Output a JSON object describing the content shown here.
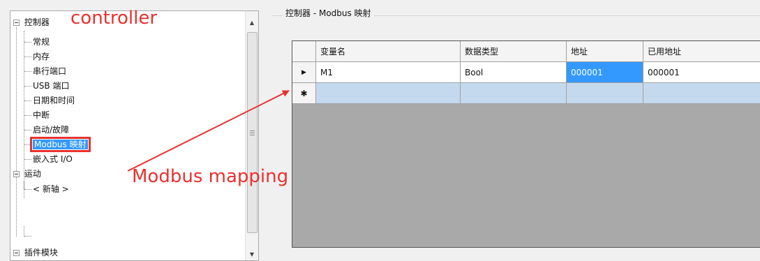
{
  "tree": {
    "items": [
      {
        "label": "控制器"
      },
      {
        "label": "常规"
      },
      {
        "label": "内存"
      },
      {
        "label": "串行端口"
      },
      {
        "label": "USB 端口"
      },
      {
        "label": "日期和时间"
      },
      {
        "label": "中断"
      },
      {
        "label": "启动/故障"
      },
      {
        "label": "Modbus 映射"
      },
      {
        "label": "嵌入式 I/O"
      },
      {
        "label": "运动"
      },
      {
        "label": "< 新轴 >"
      },
      {
        "label": "插件模块"
      }
    ]
  },
  "annotations": {
    "controller": "controller",
    "modbus_mapping": "Modbus mapping",
    "color": "#e8322f"
  },
  "panel": {
    "title": "控制器 - Modbus 映射"
  },
  "grid": {
    "columns": [
      "变量名",
      "数据类型",
      "地址",
      "已用地址"
    ],
    "rows": [
      {
        "marker": "▶",
        "cells": [
          "M1",
          "Bool",
          "000001",
          "000001"
        ]
      }
    ],
    "new_row_marker": "✱"
  },
  "colors": {
    "selection": "#3399ff",
    "new_row": "#c5d9ee",
    "grid_background": "#a9a9a9"
  }
}
